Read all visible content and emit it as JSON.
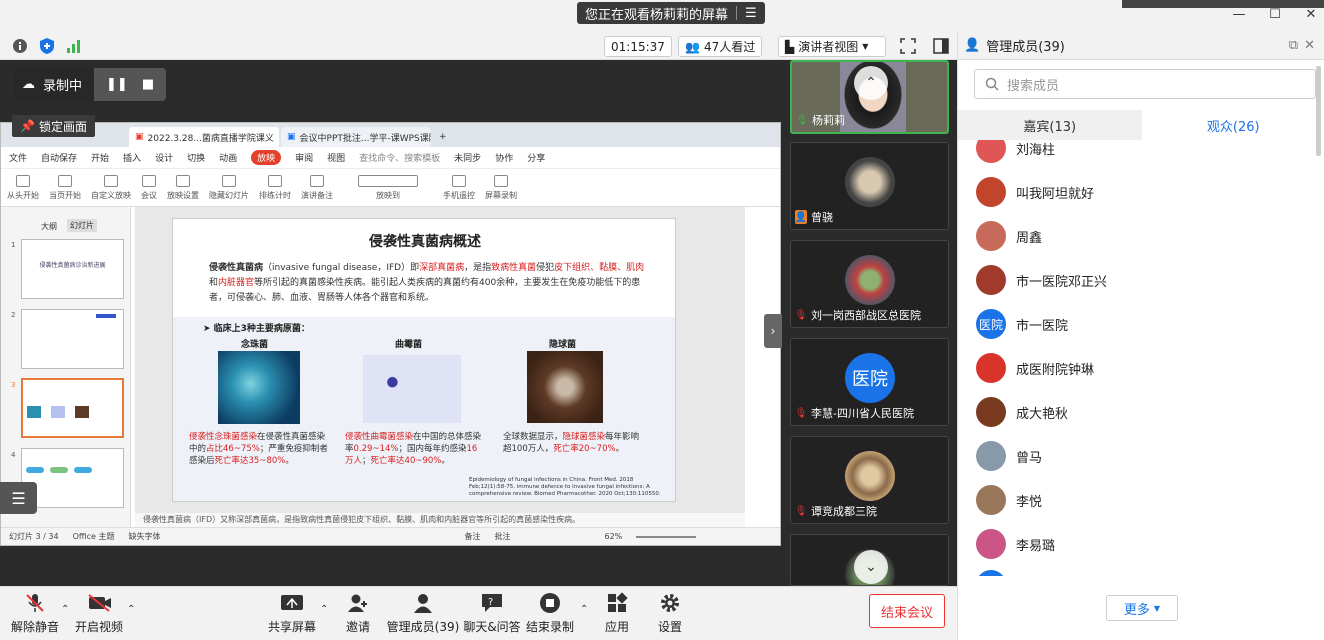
{
  "banner": {
    "text": "您正在观看杨莉莉的屏幕"
  },
  "toolbar": {
    "timer": "01:15:37",
    "viewers": "47人看过",
    "view_mode": "演讲者视图"
  },
  "recording": {
    "label": "录制中",
    "lock": "锁定画面"
  },
  "wps": {
    "tabs": [
      "2022.3.28...菌病直播学院课义",
      "会议中PPT批注...学平-课WPS课院"
    ],
    "menu": [
      "文件",
      "自动保存",
      "开始",
      "插入",
      "设计",
      "切换",
      "动画",
      "放映",
      "审阅",
      "视图",
      "查找命令、搜索模板",
      "未同步",
      "协作",
      "分享"
    ],
    "active_menu": "放映",
    "ribbon": [
      "从头开始",
      "当页开始",
      "自定义放映",
      "会议",
      "放映设置",
      "隐藏幻灯片",
      "排练计时",
      "演讲备注",
      "放映到",
      "手机遥控",
      "屏幕录制"
    ],
    "left_tabs": [
      "大纲",
      "幻灯片"
    ],
    "thumb_nums": [
      "1",
      "2",
      "3",
      "4"
    ],
    "thumb1": "侵袭性真菌病诊治新进展",
    "slide": {
      "title": "侵袭性真菌病概述",
      "p1_a": "侵袭性真菌病",
      "p1_b": "（invasive fungal disease，IFD）即",
      "p1_c": "深部真菌病",
      "p1_d": "，是指",
      "p1_e": "致病性真菌",
      "p1_f": "侵犯",
      "p1_g": "皮下组织、黏膜、肌肉",
      "p1_h": "和",
      "p1_i": "内脏器官",
      "p1_j": "等所引起的真菌感染性疾病。能引起人类疾病的真菌约有400余种，主要发生在免疫功能低下的患者，可侵袭心、肺、血液、胃肠等人体各个器官和系统。",
      "subhead": "➤  临床上3种主要病原菌：",
      "c1_title": "念珠菌",
      "c2_title": "曲霉菌",
      "c3_title": "隐球菌",
      "c1_a": "侵袭性念珠菌感染",
      "c1_b": "在侵袭性真菌感染中的",
      "c1_c": "占比46~75%",
      "c1_d": "；严重免疫抑制者感染后",
      "c1_e": "死亡率达35~80%",
      "c1_f": "。",
      "c2_a": "侵袭性曲霉菌感染",
      "c2_b": "在中国的总体感染率",
      "c2_c": "0.29~14%",
      "c2_d": "；国内每年约感染",
      "c2_e": "16万人",
      "c2_f": "；",
      "c2_g": "死亡率达40~90%",
      "c2_h": "。",
      "c3_a": "全球数据显示，",
      "c3_b": "隐球菌感染",
      "c3_c": "每年影响超100万人，",
      "c3_d": "死亡率20~70%",
      "c3_e": "。",
      "ref": "Epidemiology of fungal infections in China. Front Med. 2018 Feb;12(1):58-75. immune defence to invasive fungal infections: A comprehensive review. Biomed Pharmacother. 2020 Oct;130:110550."
    },
    "notes": "侵袭性真菌病（IFD）又称深部真菌病，是指致病性真菌侵犯皮下组织、黏膜、肌肉和内脏器官等所引起的真菌感染性疾病。",
    "status": [
      "幻灯片 3 / 34",
      "Office 主题",
      "缺失字体",
      "备注",
      "批注",
      "62%"
    ]
  },
  "videos": [
    {
      "name": "杨莉莉"
    },
    {
      "name": "曾骁"
    },
    {
      "name": "刘一岗西部战区总医院"
    },
    {
      "name": "李慧-四川省人民医院",
      "avatar_text": "医院"
    },
    {
      "name": "谭竞成都三院"
    }
  ],
  "panel": {
    "title": "管理成员(39)",
    "search_placeholder": "搜索成员",
    "tab_guests": "嘉宾(13)",
    "tab_audience": "观众(26)",
    "members": [
      {
        "name": "刘海柱",
        "color": "#e05555"
      },
      {
        "name": "叫我阿坦就好",
        "color": "#c0452b"
      },
      {
        "name": "周鑫",
        "color": "#c86a5a"
      },
      {
        "name": "市一医院邓正兴",
        "color": "#a03a2a"
      },
      {
        "name": "市一医院",
        "color": "#1a73e8",
        "text": "医院"
      },
      {
        "name": "成医附院钟琳",
        "color": "#d9342b"
      },
      {
        "name": "成大艳秋",
        "color": "#7a3a20"
      },
      {
        "name": "曾马",
        "color": "#8899aa"
      },
      {
        "name": "李悦",
        "color": "#99775a"
      },
      {
        "name": "李易璐",
        "color": "#cc5588"
      }
    ],
    "more": "更多"
  },
  "bottom": {
    "mute": "解除静音",
    "video": "开启视频",
    "share": "共享屏幕",
    "invite": "邀请",
    "members": "管理成员(39)",
    "chat": "聊天&问答",
    "stop_rec": "结束录制",
    "apps": "应用",
    "settings": "设置",
    "end": "结束会议"
  },
  "colors": {
    "accent": "#1a73e8",
    "end": "#e33333",
    "active_speaker": "#3fb34f",
    "wps_active": "#e2412b"
  }
}
